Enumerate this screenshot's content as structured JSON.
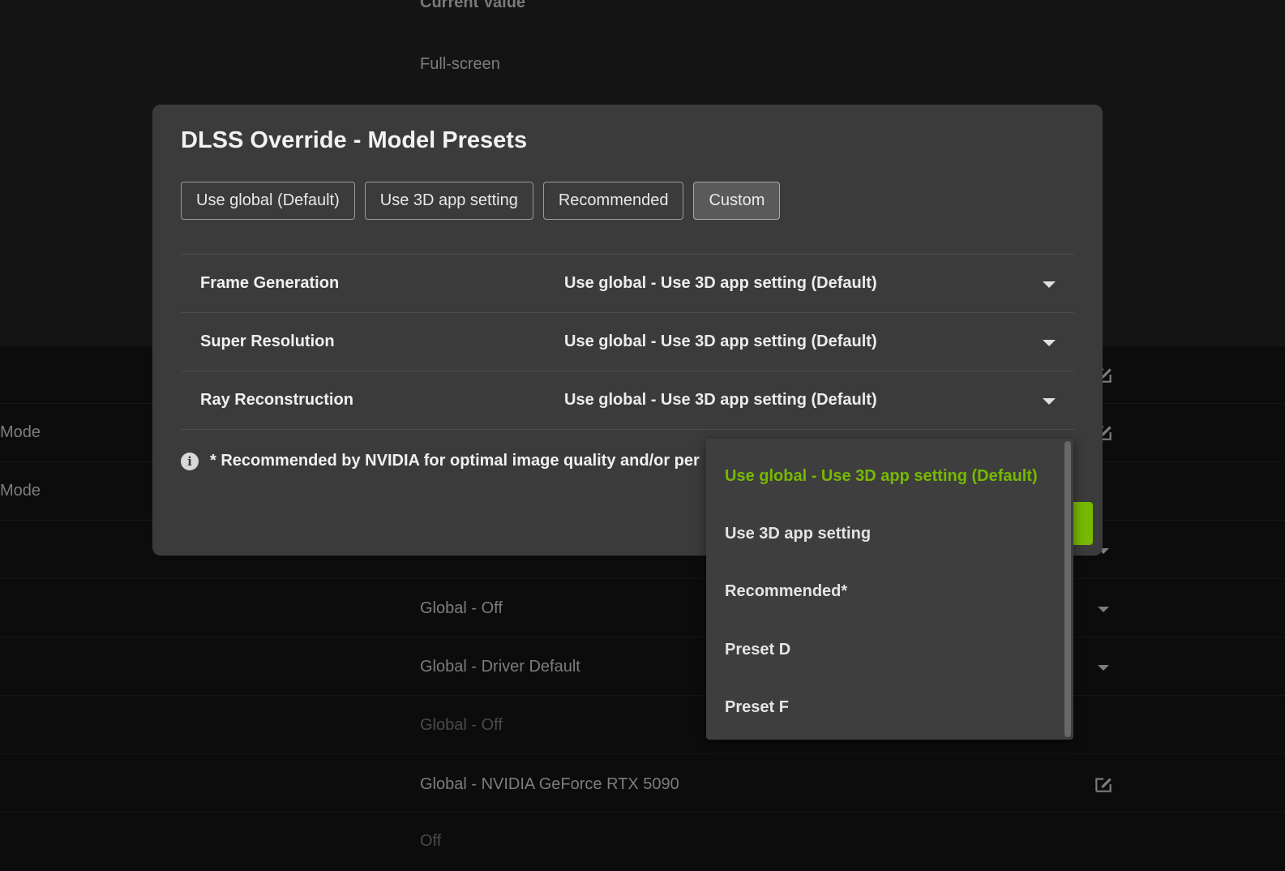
{
  "background": {
    "column_header": "Current Value",
    "rows": [
      {
        "value": "Full-screen"
      },
      {
        "left_label": "Mode"
      },
      {
        "left_label": "Mode"
      },
      {
        "value": "Global - Off"
      },
      {
        "value": "Global - Off"
      },
      {
        "value": "Global - Driver Default"
      },
      {
        "value": "Global - Off"
      },
      {
        "value": "Global - NVIDIA GeForce RTX 5090"
      },
      {
        "value": "Off"
      }
    ]
  },
  "modal": {
    "title": "DLSS Override - Model Presets",
    "preset_tabs": [
      {
        "label": "Use global (Default)"
      },
      {
        "label": "Use 3D app setting"
      },
      {
        "label": "Recommended"
      },
      {
        "label": "Custom",
        "active": true
      }
    ],
    "settings": [
      {
        "label": "Frame Generation",
        "value": "Use global - Use 3D app setting (Default)"
      },
      {
        "label": "Super Resolution",
        "value": "Use global - Use 3D app setting (Default)"
      },
      {
        "label": "Ray Reconstruction",
        "value": "Use global - Use 3D app setting (Default)"
      }
    ],
    "footnote": "* Recommended by NVIDIA for optimal image quality and/or per"
  },
  "dropdown": {
    "selected_index": 0,
    "options": [
      {
        "label": "Use global - Use 3D app setting (Default)"
      },
      {
        "label": "Use 3D app setting"
      },
      {
        "label": "Recommended*"
      },
      {
        "label": "Preset D"
      },
      {
        "label": "Preset F"
      }
    ]
  },
  "colors": {
    "accent": "#76b900",
    "modal_bg": "#3b3b3b",
    "page_bg": "#0c0c0c"
  }
}
